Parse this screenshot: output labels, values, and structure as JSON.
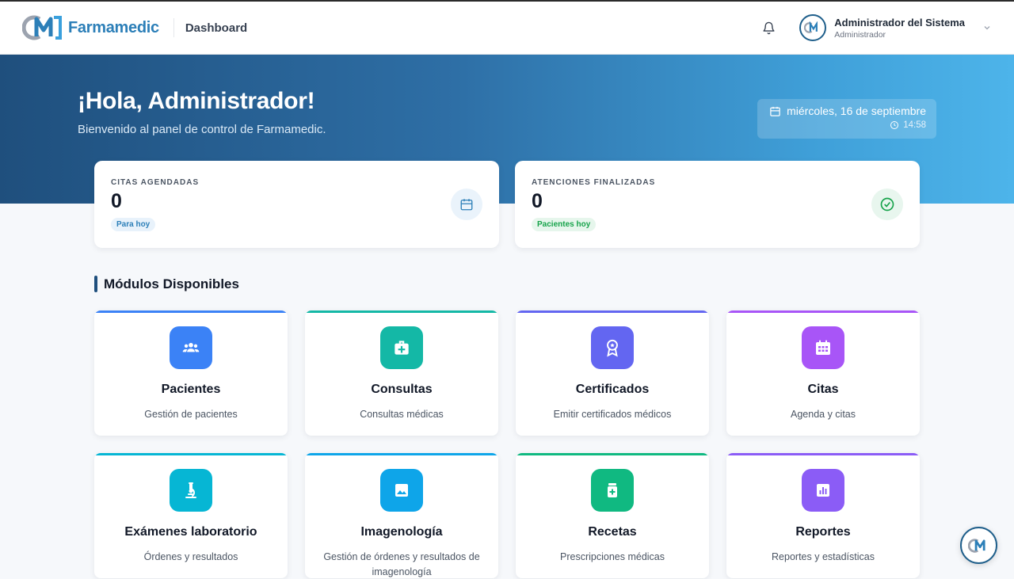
{
  "header": {
    "brand": "Farmamedic",
    "page": "Dashboard",
    "user_name": "Administrador del Sistema",
    "user_role": "Administrador",
    "icons": [
      "logo-icon",
      "bell-icon",
      "avatar-icon",
      "chevron-down-icon"
    ]
  },
  "hero": {
    "greeting": "¡Hola, Administrador!",
    "subtitle": "Bienvenido al panel de control de Farmamedic.",
    "date": "miércoles, 16 de septiembre",
    "time": "14:58"
  },
  "stats": [
    {
      "label": "CITAS AGENDADAS",
      "value": "0",
      "tag": "Para hoy",
      "icon": "calendar-icon",
      "color": "#2c7fb8"
    },
    {
      "label": "ATENCIONES FINALIZADAS",
      "value": "0",
      "tag": "Pacientes hoy",
      "icon": "check-circle-icon",
      "color": "#16a34a"
    }
  ],
  "modules": {
    "title": "Módulos Disponibles",
    "items": [
      {
        "title": "Pacientes",
        "desc": "Gestión de pacientes",
        "icon": "users-icon",
        "color": "#3b82f6"
      },
      {
        "title": "Consultas",
        "desc": "Consultas médicas",
        "icon": "medical-kit-icon",
        "color": "#14b8a6"
      },
      {
        "title": "Certificados",
        "desc": "Emitir certificados médicos",
        "icon": "certificate-icon",
        "color": "#6366f1"
      },
      {
        "title": "Citas",
        "desc": "Agenda y citas",
        "icon": "calendar-grid-icon",
        "color": "#a855f7"
      },
      {
        "title": "Exámenes laboratorio",
        "desc": "Órdenes y resultados",
        "icon": "microscope-icon",
        "color": "#06b6d4"
      },
      {
        "title": "Imagenología",
        "desc": "Gestión de órdenes y resultados de imagenología",
        "icon": "image-icon",
        "color": "#0ea5e9"
      },
      {
        "title": "Recetas",
        "desc": "Prescripciones médicas",
        "icon": "prescription-icon",
        "color": "#10b981"
      },
      {
        "title": "Reportes",
        "desc": "Reportes y estadísticas",
        "icon": "chart-icon",
        "color": "#8b5cf6"
      }
    ]
  }
}
